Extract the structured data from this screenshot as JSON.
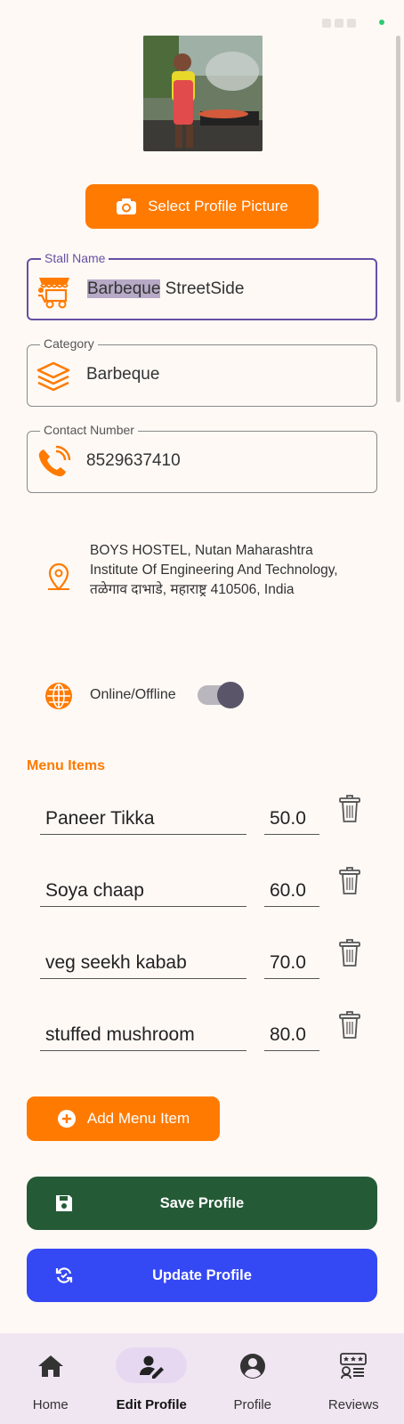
{
  "select_picture_label": "Select Profile Picture",
  "fields": {
    "stall_name": {
      "label": "Stall Name",
      "value_highlight": "Barbeque",
      "value_rest": " StreetSide"
    },
    "category": {
      "label": "Category",
      "value": "Barbeque"
    },
    "contact": {
      "label": "Contact Number",
      "value": "8529637410"
    }
  },
  "address": "BOYS HOSTEL, Nutan Maharashtra Institute Of Engineering And Technology, तळेगाव दाभाडे, महाराष्ट्र 410506, India",
  "online_label": "Online/Offline",
  "online_enabled": true,
  "menu_title": "Menu Items",
  "menu_items": [
    {
      "name": "Paneer Tikka",
      "price": "50.0"
    },
    {
      "name": "Soya chaap",
      "price": "60.0"
    },
    {
      "name": "veg seekh kabab",
      "price": "70.0"
    },
    {
      "name": "stuffed mushroom",
      "price": "80.0"
    }
  ],
  "add_menu_label": "Add Menu Item",
  "save_label": "Save Profile",
  "update_label": "Update Profile",
  "nav": [
    {
      "label": "Home",
      "icon": "home-icon"
    },
    {
      "label": "Edit Profile",
      "icon": "edit-profile-icon",
      "active": true
    },
    {
      "label": "Profile",
      "icon": "account-circle-icon"
    },
    {
      "label": "Reviews",
      "icon": "reviews-icon"
    }
  ],
  "colors": {
    "accent": "#ff7a00",
    "save": "#255a37",
    "update": "#3448f4",
    "focus": "#6750a4"
  }
}
